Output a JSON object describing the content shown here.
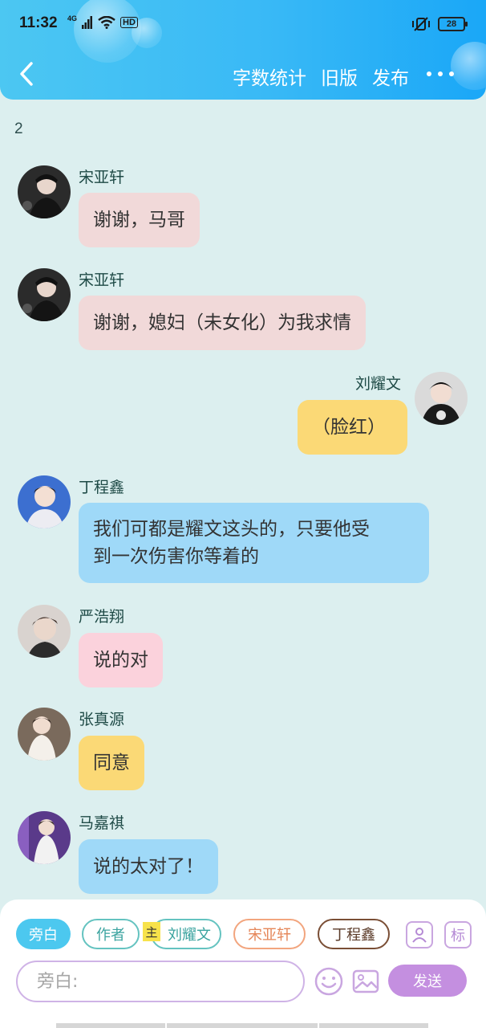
{
  "status_bar": {
    "time": "11:32",
    "network": "4G",
    "hd": "HD",
    "battery": "28"
  },
  "header": {
    "actions": [
      "字数统计",
      "旧版",
      "发布"
    ]
  },
  "chapter_number": "2",
  "messages": [
    {
      "name": "宋亚轩",
      "text": "谢谢，马哥"
    },
    {
      "name": "宋亚轩",
      "text": "谢谢，媳妇（未女化）为我求情"
    },
    {
      "name": "刘耀文",
      "text": "（脸红）"
    },
    {
      "name": "丁程鑫",
      "text": "我们可都是耀文这头的，只要他受到一次伤害你等着的",
      "lines": [
        "我们可都是耀文这头的，只要他受",
        "到一次伤害你等着的"
      ]
    },
    {
      "name": "严浩翔",
      "text": "说的对"
    },
    {
      "name": "张真源",
      "text": "同意"
    },
    {
      "name": "马嘉祺",
      "text": "说的太对了！"
    }
  ],
  "roles": {
    "narration": "旁白",
    "author": "作者",
    "main_tag": "主",
    "liu": "刘耀文",
    "song": "宋亚轩",
    "ding": "丁程鑫",
    "mark_icon": "标"
  },
  "composer": {
    "placeholder": "旁白:",
    "send_label": "发送"
  },
  "colors": {
    "header_blue": "#39b9f6",
    "chat_bg": "#dcefef",
    "bubble_pink": "#f1d9d9",
    "bubble_yellow": "#fbd976",
    "bubble_blue": "#9fd9f8",
    "bubble_rose": "#fbd2dc",
    "accent_purple": "#c48fe0"
  },
  "icons": [
    "back-arrow-icon",
    "more-icon",
    "role-manage-icon",
    "emoji-icon",
    "image-icon"
  ]
}
